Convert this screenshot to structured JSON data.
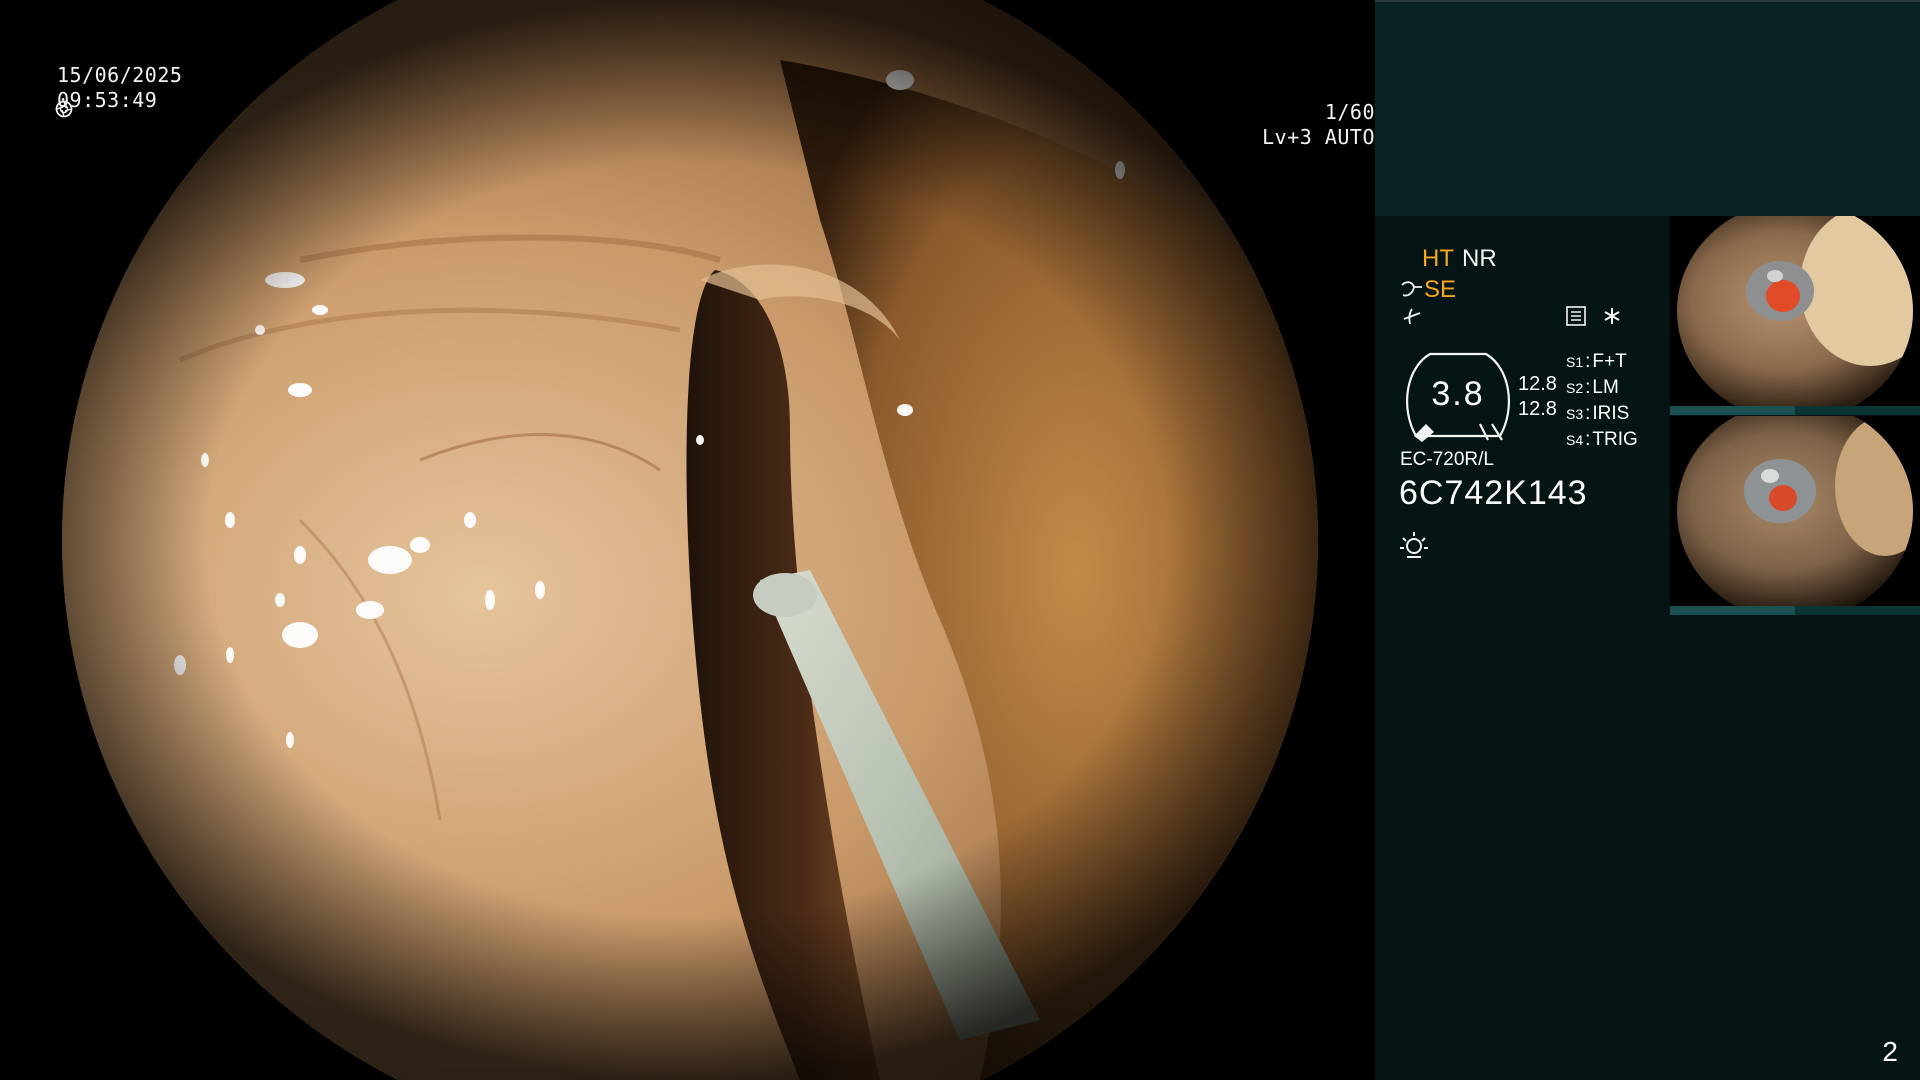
{
  "overlay": {
    "date": "15/06/2025",
    "time": "09:53:49",
    "shutter": "1/60",
    "shutter_icon": "shutter-icon",
    "iris": "Lv+3 AUTO",
    "iris_icon": "iris-icon"
  },
  "panel": {
    "mode_ht": "HT",
    "mode_nr": "NR",
    "mode_se": "SE",
    "gauge_value": "3.8",
    "gauge_num_top": "12.8",
    "gauge_num_bottom": "12.8",
    "switches": [
      {
        "key": "S1",
        "value": "F+T"
      },
      {
        "key": "S2",
        "value": "LM"
      },
      {
        "key": "S3",
        "value": "IRIS"
      },
      {
        "key": "S4",
        "value": "TRIG"
      }
    ],
    "scope_model": "EC-720R/L",
    "scope_serial": "6C742K143",
    "page_number": "2",
    "colors": {
      "accent": "#f5a623",
      "panel_bg": "#051515",
      "header_bg": "#0a2424"
    }
  }
}
